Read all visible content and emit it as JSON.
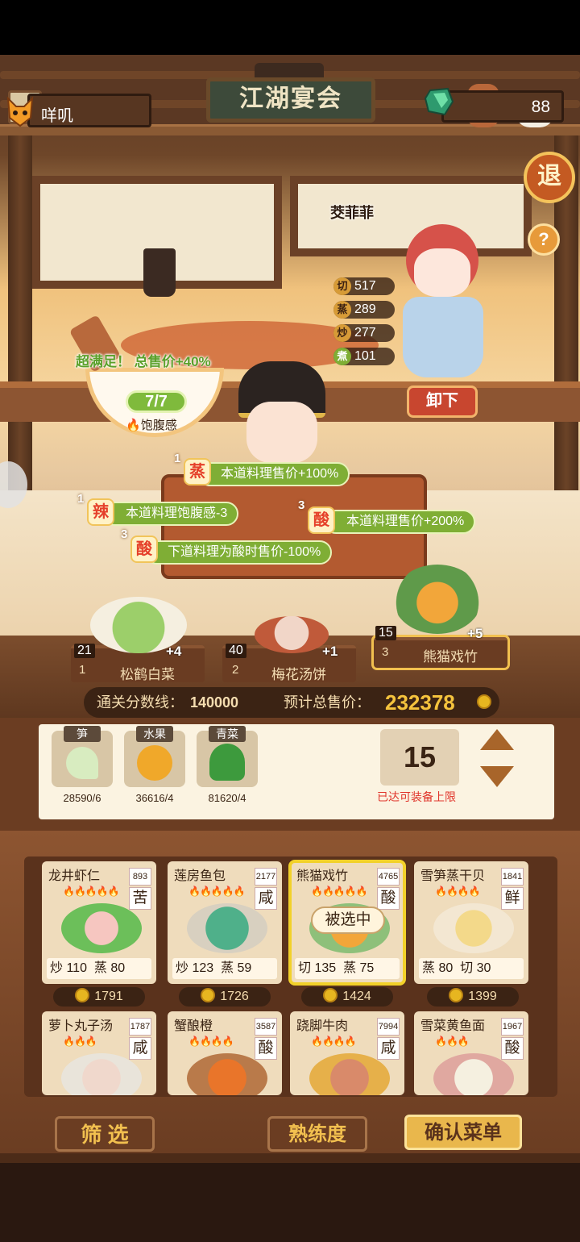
{
  "player": {
    "name": "咩叽"
  },
  "currency": {
    "gems": "88"
  },
  "title": "江湖宴会",
  "buttons": {
    "exit": "退",
    "help": "?",
    "unload": "卸下",
    "filter": "筛 选",
    "proficiency": "熟练度",
    "confirm": "确认菜单"
  },
  "chef": {
    "name": "茭菲菲",
    "stats": [
      {
        "icon": "切",
        "value": "517"
      },
      {
        "icon": "蒸",
        "value": "289"
      },
      {
        "icon": "炒",
        "value": "277"
      },
      {
        "icon": "煮",
        "value": "101"
      }
    ]
  },
  "satisfaction": {
    "text": "超满足！ 总售价+40%",
    "fullness": "7/7",
    "fullness_label": "饱腹感"
  },
  "buffs": [
    {
      "level": "1",
      "tag": "蒸",
      "text": "本道料理售价+100%"
    },
    {
      "level": "1",
      "tag": "辣",
      "text": "本道料理饱腹感-3"
    },
    {
      "level": "3",
      "tag": "酸",
      "text": "本道料理售价+200%"
    },
    {
      "level": "3",
      "tag": "酸",
      "text": "下道料理为酸时售价-100%"
    }
  ],
  "slots": [
    {
      "index": "1",
      "count": "21",
      "name": "松鹤白菜",
      "bonus": "+4"
    },
    {
      "index": "2",
      "count": "40",
      "name": "梅花汤饼",
      "bonus": "+1"
    },
    {
      "index": "3",
      "count": "15",
      "name": "熊猫戏竹",
      "bonus": "+5"
    }
  ],
  "score": {
    "pass_label": "通关分数线：",
    "pass_value": "140000",
    "total_label": "预计总售价：",
    "total_value": "232378"
  },
  "ingredients": [
    {
      "tag": "笋",
      "count": "28590/6"
    },
    {
      "tag": "水果",
      "count": "36616/4"
    },
    {
      "tag": "青菜",
      "count": "81620/4"
    }
  ],
  "limit": {
    "value": "15",
    "text": "已达可装备上限"
  },
  "menu": [
    {
      "name": "龙井虾仁",
      "price_tag": "893",
      "flavor": "苦",
      "flames": "🔥🔥🔥🔥🔥",
      "s1": "炒",
      "v1": "110",
      "s2": "蒸",
      "v2": "80",
      "sell": "1791"
    },
    {
      "name": "莲房鱼包",
      "price_tag": "2177",
      "flavor": "咸",
      "flames": "🔥🔥🔥🔥🔥",
      "s1": "炒",
      "v1": "123",
      "s2": "蒸",
      "v2": "59",
      "sell": "1726"
    },
    {
      "name": "熊猫戏竹",
      "price_tag": "4765",
      "flavor": "酸",
      "flames": "🔥🔥🔥🔥🔥",
      "s1": "切",
      "v1": "135",
      "s2": "蒸",
      "v2": "75",
      "sell": "1424",
      "selected_label": "被选中"
    },
    {
      "name": "雪笋蒸干贝",
      "price_tag": "1841",
      "flavor": "鲜",
      "flames": "🔥🔥🔥🔥",
      "s1": "蒸",
      "v1": "80",
      "s2": "切",
      "v2": "30",
      "sell": "1399"
    },
    {
      "name": "萝卜丸子汤",
      "price_tag": "1787",
      "flavor": "咸",
      "flames": "🔥🔥🔥"
    },
    {
      "name": "蟹酿橙",
      "price_tag": "3587",
      "flavor": "酸",
      "flames": "🔥🔥🔥🔥"
    },
    {
      "name": "跷脚牛肉",
      "price_tag": "7994",
      "flavor": "咸",
      "flames": "🔥🔥🔥🔥"
    },
    {
      "name": "雪菜黄鱼面",
      "price_tag": "1967",
      "flavor": "酸",
      "flames": "🔥🔥🔥"
    }
  ]
}
